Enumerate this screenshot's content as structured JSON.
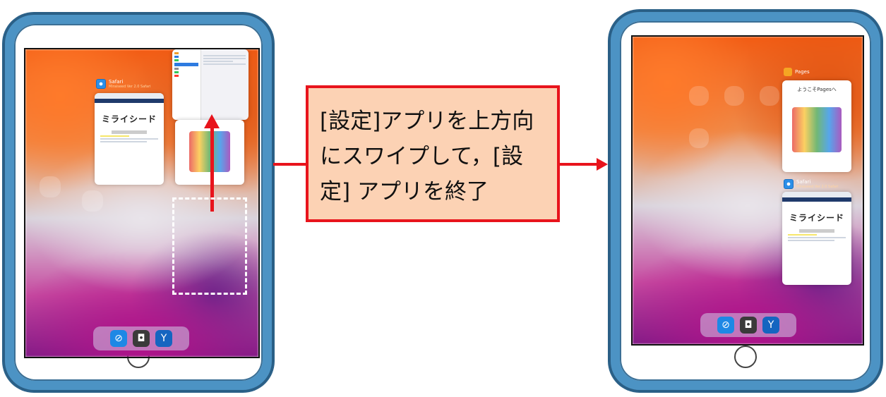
{
  "instruction": {
    "line1": "[設定]アプリを上方向",
    "line2": "にスワイプして，[設",
    "line3": "定] アプリを終了"
  },
  "left_screen": {
    "cards": [
      {
        "app": "Safari",
        "sub": "Miraiseed Ver 2.0 Safari",
        "logo": "ミライシード"
      },
      {
        "app": "設定",
        "sub": ""
      }
    ],
    "dock_icons": [
      "safari-icon",
      "camera-icon",
      "miraiseed-icon"
    ]
  },
  "right_screen": {
    "cards": [
      {
        "app": "Pages",
        "sub": "",
        "heading": "ようこそPagesへ"
      },
      {
        "app": "Safari",
        "sub": "Miraiseed Ver 2.0 Safari",
        "logo": "ミライシード"
      }
    ],
    "dock_icons": [
      "safari-icon",
      "camera-icon",
      "miraiseed-icon"
    ]
  },
  "colors": {
    "frame": "#4c93c4",
    "accent_red": "#e8141c",
    "callout_fill": "#fcd2b4"
  }
}
